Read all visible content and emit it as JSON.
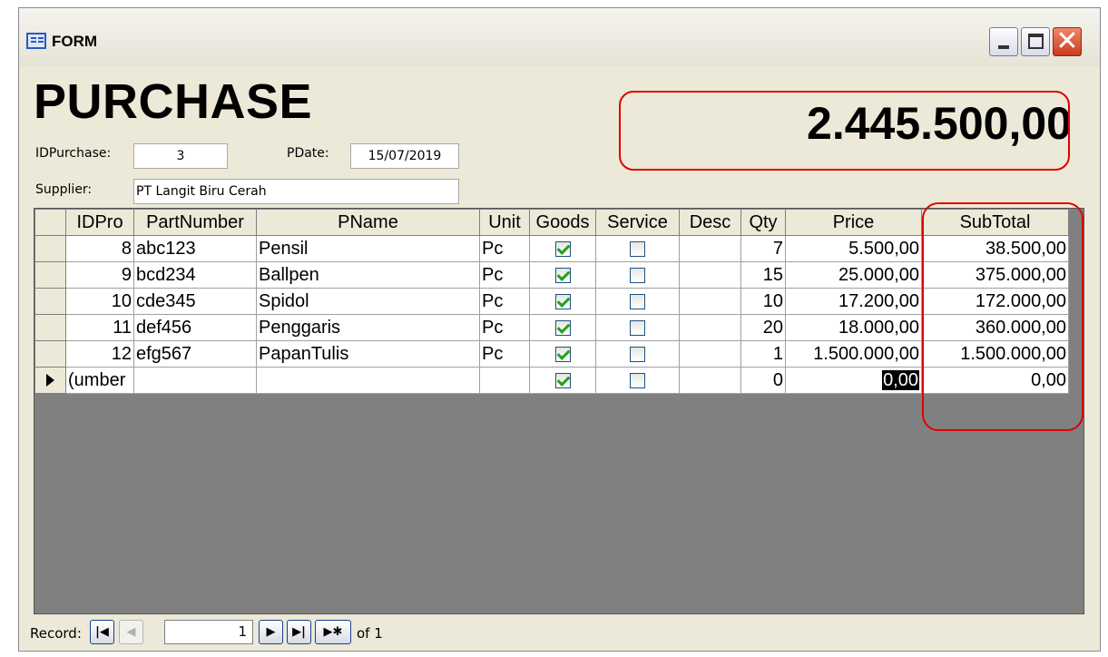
{
  "window": {
    "title": "FORM"
  },
  "form": {
    "heading": "PURCHASE",
    "idpurchase_label": "IDPurchase:",
    "idpurchase_value": "3",
    "pdate_label": "PDate:",
    "pdate_value": "15/07/2019",
    "supplier_label": "Supplier:",
    "supplier_value": "PT Langit Biru Cerah",
    "grand_total": "2.445.500,00"
  },
  "grid": {
    "columns": [
      "IDPro",
      "PartNumber",
      "PName",
      "Unit",
      "Goods",
      "Service",
      "Desc",
      "Qty",
      "Price",
      "SubTotal"
    ],
    "rows": [
      {
        "idpro": "8",
        "partnumber": "abc123",
        "pname": "Pensil",
        "unit": "Pc",
        "goods": true,
        "service": false,
        "desc": "",
        "qty": "7",
        "price": "5.500,00",
        "subtotal": "38.500,00"
      },
      {
        "idpro": "9",
        "partnumber": "bcd234",
        "pname": "Ballpen",
        "unit": "Pc",
        "goods": true,
        "service": false,
        "desc": "",
        "qty": "15",
        "price": "25.000,00",
        "subtotal": "375.000,00"
      },
      {
        "idpro": "10",
        "partnumber": "cde345",
        "pname": "Spidol",
        "unit": "Pc",
        "goods": true,
        "service": false,
        "desc": "",
        "qty": "10",
        "price": "17.200,00",
        "subtotal": "172.000,00"
      },
      {
        "idpro": "11",
        "partnumber": "def456",
        "pname": "Penggaris",
        "unit": "Pc",
        "goods": true,
        "service": false,
        "desc": "",
        "qty": "20",
        "price": "18.000,00",
        "subtotal": "360.000,00"
      },
      {
        "idpro": "12",
        "partnumber": "efg567",
        "pname": "PapanTulis",
        "unit": "Pc",
        "goods": true,
        "service": false,
        "desc": "",
        "qty": "1",
        "price": "1.500.000,00",
        "subtotal": "1.500.000,00"
      }
    ],
    "new_row": {
      "idpro": "umber)",
      "qty": "0",
      "price": "0,00",
      "subtotal": "0,00",
      "goods": true,
      "service": false
    }
  },
  "navigator": {
    "label": "Record:",
    "current": "1",
    "of_text": "of 1",
    "icons": {
      "first": "first-record-icon",
      "prev": "prev-record-icon",
      "next": "next-record-icon",
      "last": "last-record-icon",
      "new": "new-record-icon"
    }
  },
  "colors": {
    "annotation": "#e00000",
    "check": "#21a121",
    "grid_background": "#808080",
    "form_background": "#ECE9D8"
  }
}
